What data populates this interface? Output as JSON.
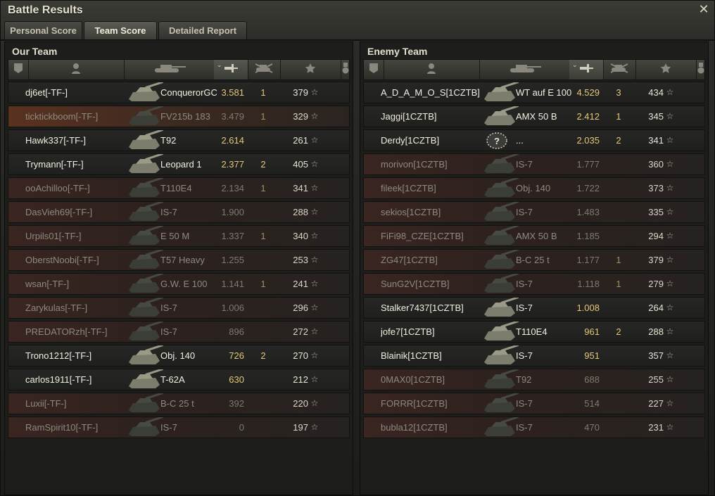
{
  "window": {
    "title": "Battle Results",
    "close_glyph": "✕"
  },
  "tabs": [
    {
      "label": "Personal Score",
      "active": false
    },
    {
      "label": "Team Score",
      "active": true
    },
    {
      "label": "Detailed Report",
      "active": false
    }
  ],
  "header_icons": [
    "platoon-icon",
    "player-icon",
    "tank-icon",
    "damage-icon",
    "kills-icon",
    "xp-star-icon",
    "medal-icon"
  ],
  "star_glyph": "☆",
  "our_team": {
    "title": "Our Team",
    "rows": [
      {
        "name": "dj6et[-TF-]",
        "vehicle": "ConquerorGC",
        "damage": "3.581",
        "kills": "1",
        "xp": "379",
        "dead": false,
        "me": false
      },
      {
        "name": "ticktickboom[-TF-]",
        "vehicle": "FV215b 183",
        "damage": "3.479",
        "kills": "1",
        "xp": "329",
        "dead": true,
        "me": true
      },
      {
        "name": "Hawk337[-TF-]",
        "vehicle": "T92",
        "damage": "2.614",
        "kills": "",
        "xp": "261",
        "dead": false,
        "me": false
      },
      {
        "name": "Trymann[-TF-]",
        "vehicle": "Leopard 1",
        "damage": "2.377",
        "kills": "2",
        "xp": "405",
        "dead": false,
        "me": false
      },
      {
        "name": "ooAchilloo[-TF-]",
        "vehicle": "T110E4",
        "damage": "2.134",
        "kills": "1",
        "xp": "341",
        "dead": true,
        "me": false
      },
      {
        "name": "DasVieh69[-TF-]",
        "vehicle": "IS-7",
        "damage": "1.900",
        "kills": "",
        "xp": "288",
        "dead": true,
        "me": false
      },
      {
        "name": "Urpils01[-TF-]",
        "vehicle": "E 50 M",
        "damage": "1.337",
        "kills": "1",
        "xp": "340",
        "dead": true,
        "me": false
      },
      {
        "name": "OberstNoobi[-TF-]",
        "vehicle": "T57 Heavy",
        "damage": "1.255",
        "kills": "",
        "xp": "253",
        "dead": true,
        "me": false
      },
      {
        "name": "wsan[-TF-]",
        "vehicle": "G.W. E 100",
        "damage": "1.141",
        "kills": "1",
        "xp": "241",
        "dead": true,
        "me": false
      },
      {
        "name": "Zarykulas[-TF-]",
        "vehicle": "IS-7",
        "damage": "1.006",
        "kills": "",
        "xp": "296",
        "dead": true,
        "me": false
      },
      {
        "name": "PREDATORzh[-TF-]",
        "vehicle": "IS-7",
        "damage": "896",
        "kills": "",
        "xp": "272",
        "dead": true,
        "me": false
      },
      {
        "name": "Trono1212[-TF-]",
        "vehicle": "Obj. 140",
        "damage": "726",
        "kills": "2",
        "xp": "270",
        "dead": false,
        "me": false
      },
      {
        "name": "carlos1911[-TF-]",
        "vehicle": "T-62A",
        "damage": "630",
        "kills": "",
        "xp": "212",
        "dead": false,
        "me": false
      },
      {
        "name": "Luxii[-TF-]",
        "vehicle": "B-C 25 t",
        "damage": "392",
        "kills": "",
        "xp": "220",
        "dead": true,
        "me": false
      },
      {
        "name": "RamSpirit10[-TF-]",
        "vehicle": "IS-7",
        "damage": "0",
        "kills": "",
        "xp": "197",
        "dead": true,
        "me": false
      }
    ]
  },
  "enemy_team": {
    "title": "Enemy Team",
    "rows": [
      {
        "name": "A_D_A_M_O_S[1CZTB]",
        "vehicle": "WT auf E 100",
        "damage": "4.529",
        "kills": "3",
        "xp": "434",
        "dead": false,
        "me": false
      },
      {
        "name": "Jaggi[1CZTB]",
        "vehicle": "AMX 50 B",
        "damage": "2.412",
        "kills": "1",
        "xp": "345",
        "dead": false,
        "me": false
      },
      {
        "name": "Derdy[1CZTB]",
        "vehicle": "...",
        "damage": "2.035",
        "kills": "2",
        "xp": "341",
        "dead": false,
        "me": false,
        "unknown": true
      },
      {
        "name": "morivon[1CZTB]",
        "vehicle": "IS-7",
        "damage": "1.777",
        "kills": "",
        "xp": "360",
        "dead": true,
        "me": false
      },
      {
        "name": "fileek[1CZTB]",
        "vehicle": "Obj. 140",
        "damage": "1.722",
        "kills": "",
        "xp": "373",
        "dead": true,
        "me": false
      },
      {
        "name": "sekios[1CZTB]",
        "vehicle": "IS-7",
        "damage": "1.483",
        "kills": "",
        "xp": "335",
        "dead": true,
        "me": false
      },
      {
        "name": "FiFi98_CZE[1CZTB]",
        "vehicle": "AMX 50 B",
        "damage": "1.185",
        "kills": "",
        "xp": "294",
        "dead": true,
        "me": false
      },
      {
        "name": "ZG47[1CZTB]",
        "vehicle": "B-C 25 t",
        "damage": "1.177",
        "kills": "1",
        "xp": "379",
        "dead": true,
        "me": false
      },
      {
        "name": "SunG2V[1CZTB]",
        "vehicle": "IS-7",
        "damage": "1.118",
        "kills": "1",
        "xp": "279",
        "dead": true,
        "me": false
      },
      {
        "name": "Stalker7437[1CZTB]",
        "vehicle": "IS-7",
        "damage": "1.008",
        "kills": "",
        "xp": "264",
        "dead": false,
        "me": false
      },
      {
        "name": "jofe7[1CZTB]",
        "vehicle": "T110E4",
        "damage": "961",
        "kills": "2",
        "xp": "288",
        "dead": false,
        "me": false
      },
      {
        "name": "Blainik[1CZTB]",
        "vehicle": "IS-7",
        "damage": "951",
        "kills": "",
        "xp": "357",
        "dead": false,
        "me": false
      },
      {
        "name": "0MAX0[1CZTB]",
        "vehicle": "T92",
        "damage": "688",
        "kills": "",
        "xp": "255",
        "dead": true,
        "me": false
      },
      {
        "name": "FORRR[1CZTB]",
        "vehicle": "IS-7",
        "damage": "514",
        "kills": "",
        "xp": "227",
        "dead": true,
        "me": false
      },
      {
        "name": "bubla12[1CZTB]",
        "vehicle": "IS-7",
        "damage": "470",
        "kills": "",
        "xp": "231",
        "dead": true,
        "me": false
      }
    ]
  }
}
